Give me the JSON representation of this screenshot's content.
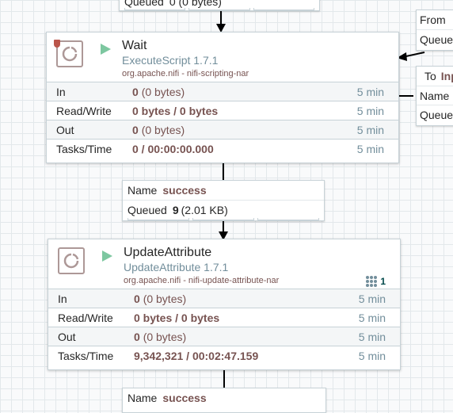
{
  "top_connection": {
    "queued_label": "Queued",
    "queued_value": "0 (0 bytes)"
  },
  "wait_processor": {
    "name": "Wait",
    "type": "ExecuteScript 1.7.1",
    "bundle": "org.apache.nifi - nifi-scripting-nar",
    "stats": [
      {
        "label": "In",
        "bold": "0",
        "rest": "(0 bytes)",
        "time": "5 min"
      },
      {
        "label": "Read/Write",
        "bold": "0 bytes / 0 bytes",
        "rest": "",
        "time": "5 min"
      },
      {
        "label": "Out",
        "bold": "0",
        "rest": "(0 bytes)",
        "time": "5 min"
      },
      {
        "label": "Tasks/Time",
        "bold": "0 / 00:00:00.000",
        "rest": "",
        "time": "5 min"
      }
    ]
  },
  "middle_connection": {
    "name_label": "Name",
    "name_value": "success",
    "queued_label": "Queued",
    "queued_count": "9",
    "queued_size": "(2.01 KB)"
  },
  "update_processor": {
    "name": "UpdateAttribute",
    "type": "UpdateAttribute 1.7.1",
    "bundle": "org.apache.nifi - nifi-update-attribute-nar",
    "active_threads": "1",
    "stats": [
      {
        "label": "In",
        "bold": "0",
        "rest": "(0 bytes)",
        "time": "5 min"
      },
      {
        "label": "Read/Write",
        "bold": "0 bytes / 0 bytes",
        "rest": "",
        "time": "5 min"
      },
      {
        "label": "Out",
        "bold": "0",
        "rest": "(0 bytes)",
        "time": "5 min"
      },
      {
        "label": "Tasks/Time",
        "bold": "9,342,321 / 00:02:47.159",
        "rest": "",
        "time": "5 min"
      }
    ]
  },
  "bottom_connection": {
    "name_label": "Name",
    "name_value": "success"
  },
  "side_top": {
    "from_label": "From",
    "queued_label": "Queue"
  },
  "side_bottom": {
    "to_label": "To",
    "to_value": "Inp",
    "name_label": "Name",
    "queued_label": "Queue"
  },
  "colors": {
    "running": "#7dc7a0",
    "bulletin": "#ba554a",
    "type_text": "#728e9b",
    "value_text": "#775351"
  },
  "icons": {
    "run": "play-triangle",
    "processor": "processor-gear",
    "bulletin": "bulletin-flag",
    "threads": "active-threads-dots"
  }
}
